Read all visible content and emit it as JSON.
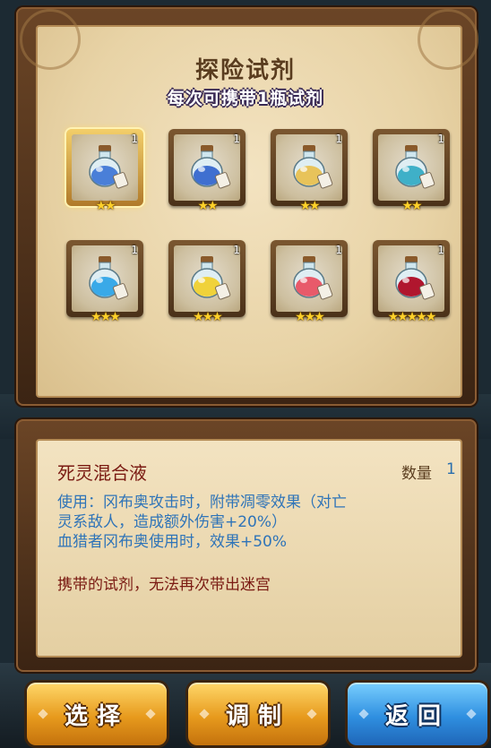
{
  "panel": {
    "title": "探险试剂",
    "subtitle": "每次可携带1瓶试剂"
  },
  "slots": [
    {
      "count": "1",
      "stars": "★★",
      "color": "#4a7fd8",
      "selected": true
    },
    {
      "count": "1",
      "stars": "★★",
      "color": "#3f6fd0",
      "selected": false
    },
    {
      "count": "1",
      "stars": "★★",
      "color": "#e8c35a",
      "selected": false
    },
    {
      "count": "1",
      "stars": "★★",
      "color": "#3fb0c8",
      "selected": false
    },
    {
      "count": "1",
      "stars": "★★★",
      "color": "#39a9e8",
      "selected": false
    },
    {
      "count": "1",
      "stars": "★★★",
      "color": "#f0d23a",
      "selected": false
    },
    {
      "count": "1",
      "stars": "★★★",
      "color": "#e85a6a",
      "selected": false
    },
    {
      "count": "1",
      "stars": "★★★★★",
      "color": "#b0162e",
      "selected": false
    }
  ],
  "detail": {
    "name": "死灵混合液",
    "quantity_label": "数量",
    "quantity_value": "1",
    "usage_line1": "使用：冈布奥攻击时，附带凋零效果（对亡",
    "usage_line2": "灵系敌人，造成额外伤害+20%）",
    "usage_line3": "血猎者冈布奥使用时，效果+50%",
    "warning": "携带的试剂，无法再次带出迷宫"
  },
  "buttons": {
    "select": "选择",
    "craft": "调制",
    "back": "返回"
  }
}
